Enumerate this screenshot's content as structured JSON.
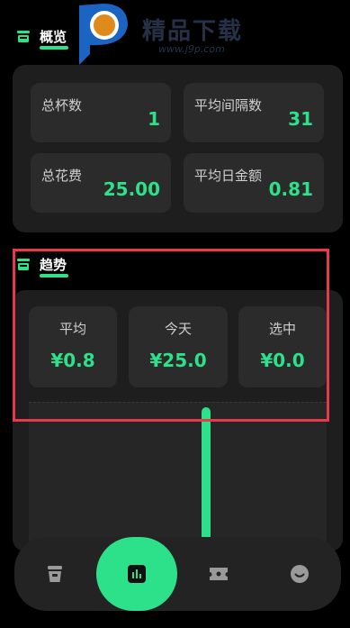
{
  "overview": {
    "title": "概览",
    "cards": [
      {
        "label": "总杯数",
        "value": "1"
      },
      {
        "label": "平均间隔数",
        "value": "31"
      },
      {
        "label": "总花费",
        "value": "25.00"
      },
      {
        "label": "平均日金额",
        "value": "0.81"
      }
    ]
  },
  "trend": {
    "title": "趋势",
    "cards": [
      {
        "label": "平均",
        "value": "¥0.8"
      },
      {
        "label": "今天",
        "value": "¥25.0"
      },
      {
        "label": "选中",
        "value": "¥0.0"
      }
    ]
  },
  "watermark": {
    "text": "精品下载",
    "url": "www.j9p.com"
  },
  "nav": {
    "items": [
      "cup-icon",
      "chart-icon",
      "ticket-icon",
      "smile-icon"
    ],
    "active_index": 1
  },
  "colors": {
    "accent": "#2de08a",
    "background": "#000000",
    "panel": "#1e1e1e",
    "card": "#2b2b2b",
    "highlight_box": "#e8394a"
  }
}
